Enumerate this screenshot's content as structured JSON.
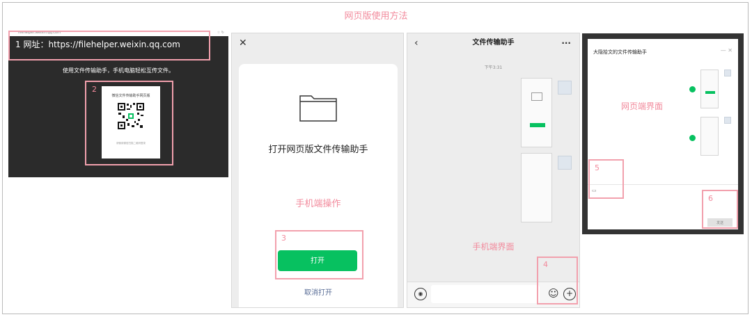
{
  "title": "网页版使用方法",
  "web": {
    "browser_url": "filehelper.weixin.qq.com",
    "annotation": "1 网址：https://filehelper.weixin.qq.com",
    "desc": "使用文件传输助手，手机电脑轻松互传文件。",
    "qr_title": "微信文件传输助手网页版",
    "qr_note": "请使用微信扫描二维码登录",
    "qr_num": "2"
  },
  "phone": {
    "close_icon": "close-icon",
    "card_title": "打开网页版文件传输助手",
    "note": "手机端操作",
    "num": "3",
    "open_button": "打开",
    "cancel_link": "取消打开"
  },
  "chat": {
    "title": "文件传输助手",
    "time": "下午3:31",
    "note": "手机端界面",
    "num": "4"
  },
  "pc": {
    "title": "大隐拾文的文件传输助手",
    "note": "网页端界面",
    "num5": "5",
    "num6": "6",
    "send_button": "发送"
  },
  "colors": {
    "accent_green": "#07c160",
    "highlight": "#f2a0ad",
    "note_pink": "#f28a9c"
  }
}
